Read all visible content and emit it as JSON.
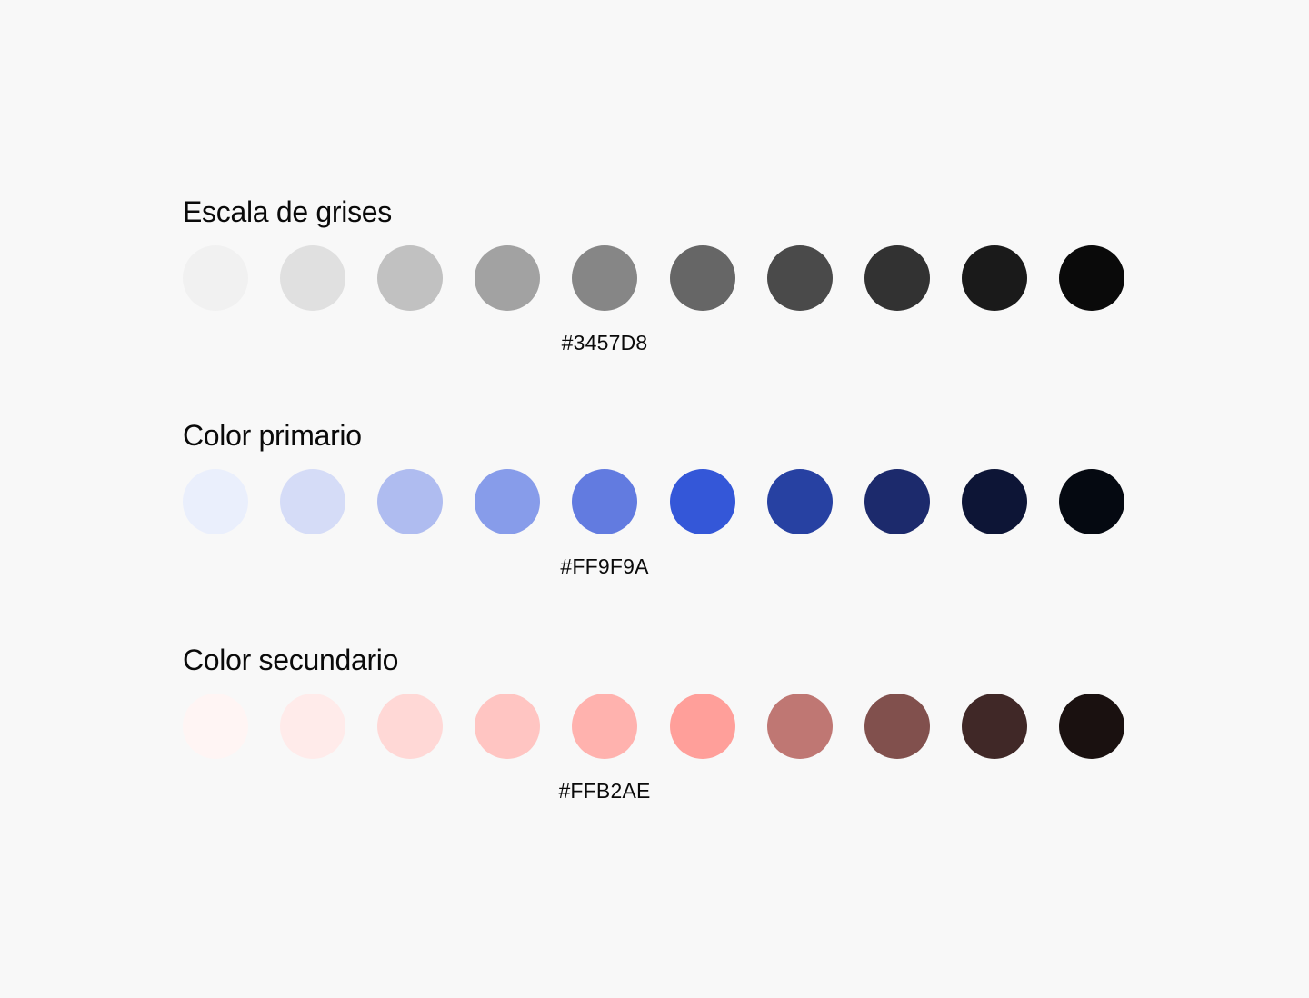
{
  "palettes": [
    {
      "title": "Escala de grises",
      "hex_label": "#3457D8",
      "swatches": [
        "#F1F1F1",
        "#E0E0E0",
        "#C1C1C1",
        "#A2A2A2",
        "#868686",
        "#666666",
        "#4A4A4A",
        "#323232",
        "#1A1A1A",
        "#0A0A0A"
      ]
    },
    {
      "title": "Color primario",
      "hex_label": "#FF9F9A",
      "swatches": [
        "#EAEFFC",
        "#D5DCF7",
        "#AFBCF0",
        "#879CEA",
        "#627BE0",
        "#3457D8",
        "#2741A2",
        "#1C2A6C",
        "#0D1536",
        "#050911"
      ]
    },
    {
      "title": "Color secundario",
      "hex_label": "#FFB2AE",
      "swatches": [
        "#FFF5F4",
        "#FFEBEA",
        "#FFD8D6",
        "#FFC5C2",
        "#FFB2AE",
        "#FF9F9A",
        "#BF7773",
        "#81504D",
        "#402827",
        "#1A1110"
      ]
    }
  ]
}
